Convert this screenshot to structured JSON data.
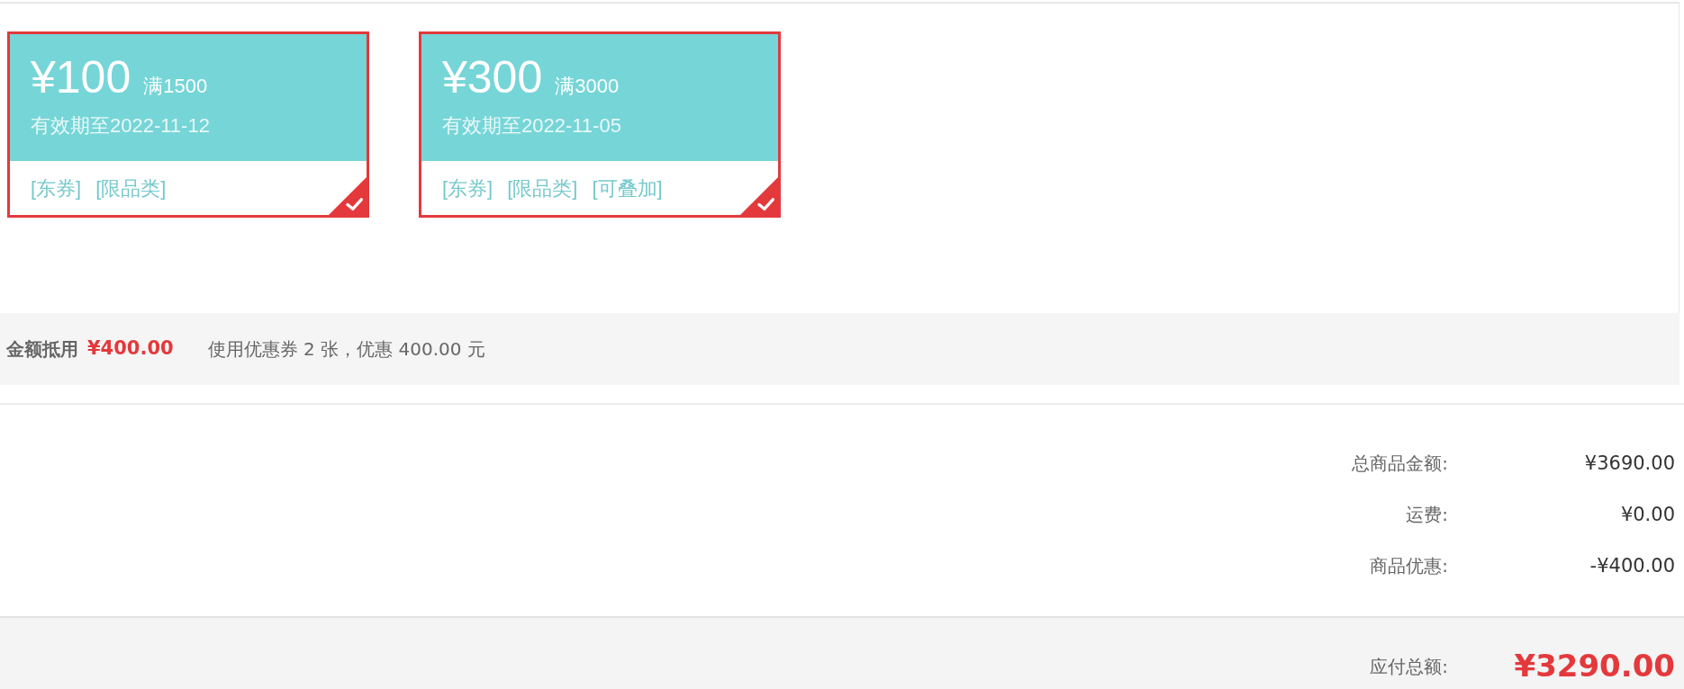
{
  "coupons": [
    {
      "amount": "¥100",
      "condition": "满1500",
      "validity": "有效期至2022-11-12",
      "tags": [
        "[东券]",
        "[限品类]"
      ],
      "selected": true
    },
    {
      "amount": "¥300",
      "condition": "满3000",
      "validity": "有效期至2022-11-05",
      "tags": [
        "[东券]",
        "[限品类]",
        "[可叠加]"
      ],
      "selected": true
    }
  ],
  "discount_summary": {
    "label": "金额抵用",
    "amount": "¥400.00",
    "note": "使用优惠券 2 张，优惠 400.00 元"
  },
  "totals": [
    {
      "label": "总商品金额:",
      "value": "¥3690.00"
    },
    {
      "label": "运费:",
      "value": "¥0.00"
    },
    {
      "label": "商品优惠:",
      "value": "-¥400.00"
    }
  ],
  "payable": {
    "label": "应付总额:",
    "value": "¥3290.00"
  }
}
